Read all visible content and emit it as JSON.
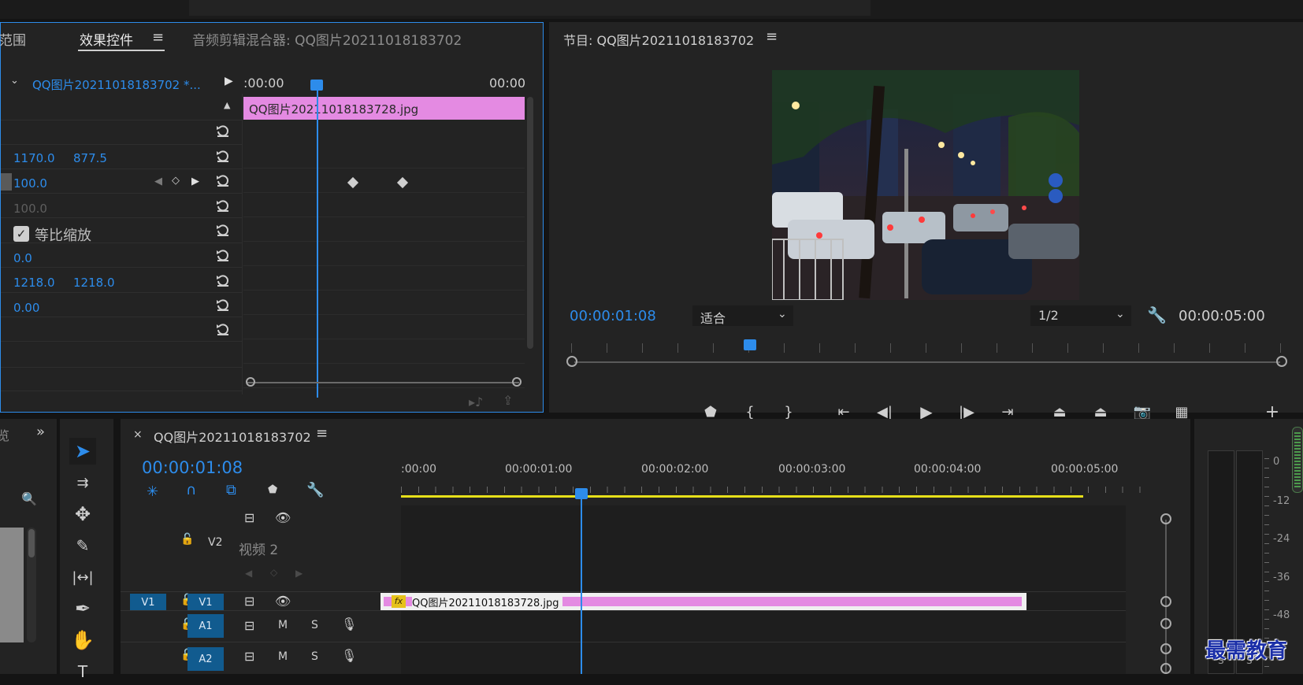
{
  "effect_controls": {
    "tab_partial": "范围",
    "tab_effects": "效果控件",
    "tab_audio_mixer": "音频剪辑混合器: QQ图片20211018183702",
    "sequence_clip": "QQ图片20211018183702 *...",
    "time_start": ":00:00",
    "time_end": "00:00",
    "clip_name": "QQ图片20211018183728.jpg",
    "position_x": "1170.0",
    "position_y": "877.5",
    "scale": "100.0",
    "scale_width": "100.0",
    "uniform_scale_label": "等比缩放",
    "rotation": "0.0",
    "anchor_x": "1218.0",
    "anchor_y": "1218.0",
    "anti_flicker": "0.00"
  },
  "program_monitor": {
    "title": "节目: QQ图片20211018183702",
    "current_time": "00:00:01:08",
    "fit_value": "适合",
    "resolution": "1/2",
    "duration": "00:00:05:00"
  },
  "timeline": {
    "title": "QQ图片20211018183702",
    "current_time": "00:00:01:08",
    "ruler": [
      ":00:00",
      "00:00:01:00",
      "00:00:02:00",
      "00:00:03:00",
      "00:00:04:00",
      "00:00:05:00"
    ],
    "v2_label": "V2",
    "v2_name": "视频 2",
    "v1_source": "V1",
    "v1_label": "V1",
    "a1_label": "A1",
    "a2_label": "A2",
    "mute": "M",
    "solo": "S",
    "clip_fx": "fx",
    "clip_name": "QQ图片20211018183728.jpg"
  },
  "meters": {
    "labels": [
      "0",
      "-12",
      "-24",
      "-36",
      "-48"
    ],
    "solo_a": "S",
    "solo_b": "S"
  },
  "watermark": "最需教育",
  "colors": {
    "accent": "#2d8ceb",
    "clip": "#e48ae2",
    "work_area": "#e6e01a"
  }
}
